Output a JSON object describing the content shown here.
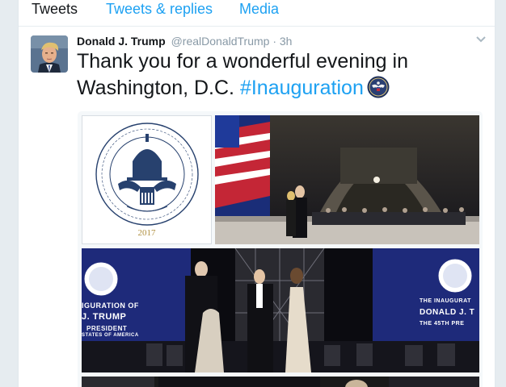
{
  "tabs": [
    {
      "label": "Tweets",
      "active": true
    },
    {
      "label": "Tweets & replies",
      "active": false
    },
    {
      "label": "Media",
      "active": false
    }
  ],
  "tweet": {
    "author_name": "Donald J. Trump",
    "handle": "@realDonaldTrump",
    "separator": "·",
    "time": "3h",
    "text": "Thank you for a wonderful evening in Washington, D.C.",
    "hashtag": "#Inauguration",
    "emoji": "presidential-seal-emoji"
  },
  "media": {
    "photo_1": {
      "year": "2017"
    },
    "photo_3": {
      "left_banner": [
        "IGURATION OF",
        "J. TRUMP",
        "PRESIDENT",
        "STATES OF AMERICA"
      ],
      "right_banner": [
        "THE INAUGURAT",
        "DONALD J. T",
        "THE 45TH PRE"
      ]
    }
  },
  "colors": {
    "link": "#1da1f2",
    "text": "#14171a",
    "muted": "#8899a6",
    "background": "#e6ecf0"
  },
  "icons": [
    "chevron-down-icon",
    "presidential-seal-emoji"
  ]
}
